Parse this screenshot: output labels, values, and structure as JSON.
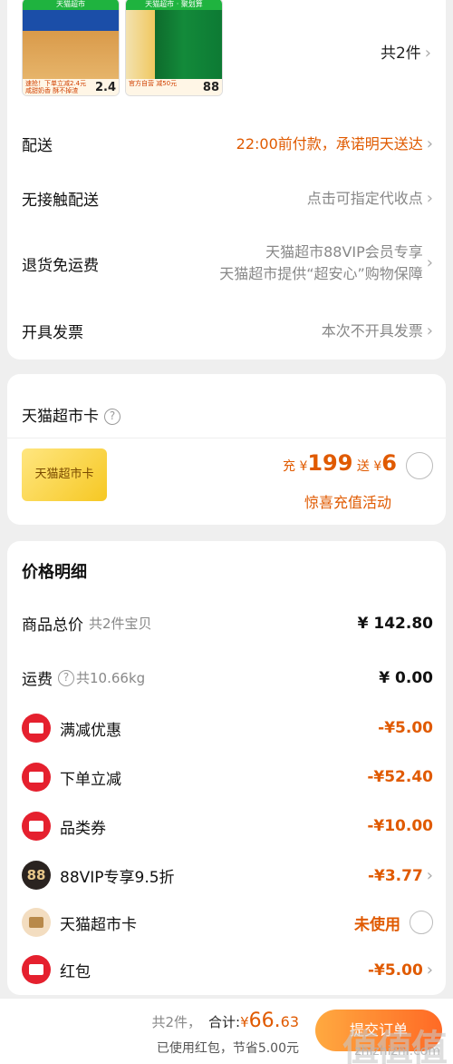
{
  "products": [
    {
      "tag": "天猫超市",
      "promo": "速抢！下单立减2.4元",
      "sub": "咸甜奶香 酥不掉渣",
      "price": "2.4"
    },
    {
      "tag": "天猫超市 · 聚划算",
      "promo": "官方自营 减50元",
      "sub": "",
      "price": "88"
    }
  ],
  "item_count": "共2件",
  "shipping": {
    "delivery_label": "配送",
    "delivery_value": "22:00前付款，承诺明天送达",
    "contactless_label": "无接触配送",
    "contactless_value": "点击可指定代收点",
    "return_label": "退货免运费",
    "return_value_1": "天猫超市88VIP会员专享",
    "return_value_2": "天猫超市提供“超安心”购物保障",
    "invoice_label": "开具发票",
    "invoice_value": "本次不开具发票"
  },
  "tmall_card": {
    "title": "天猫超市卡",
    "card_text": "天猫超市卡",
    "recharge_prefix": "充",
    "currency": "¥",
    "recharge_amount": "199",
    "gift_prefix": "送",
    "gift_amount": "6",
    "activity": "惊喜充值活动"
  },
  "price_detail": {
    "title": "价格明细",
    "rows": [
      {
        "label": "商品总价",
        "sub": "共2件宝贝",
        "amount": "¥ 142.80"
      },
      {
        "label": "运费",
        "sub": "共10.66kg",
        "amount": "¥ 0.00"
      },
      {
        "label": "满减优惠",
        "amount": "-¥5.00"
      },
      {
        "label": "下单立减",
        "amount": "-¥52.40"
      },
      {
        "label": "品类券",
        "amount": "-¥10.00"
      },
      {
        "label": "88VIP专享9.5折",
        "amount": "-¥3.77",
        "icon_text": "88"
      },
      {
        "label": "天猫超市卡",
        "amount": "未使用"
      },
      {
        "label": "红包",
        "amount": "-¥5.00"
      }
    ]
  },
  "footer": {
    "count": "共2件，",
    "total_label": "合计:",
    "currency": "¥",
    "total_int": "66.",
    "total_dec": "63",
    "saved": "已使用红包，节省5.00元",
    "submit": "提交订单",
    "watermark": "值值值",
    "watermark_url": "zhizhizhi.com"
  },
  "colors": {
    "accent": "#e05a00",
    "red": "#e5202e",
    "gold": "#f6c823"
  }
}
